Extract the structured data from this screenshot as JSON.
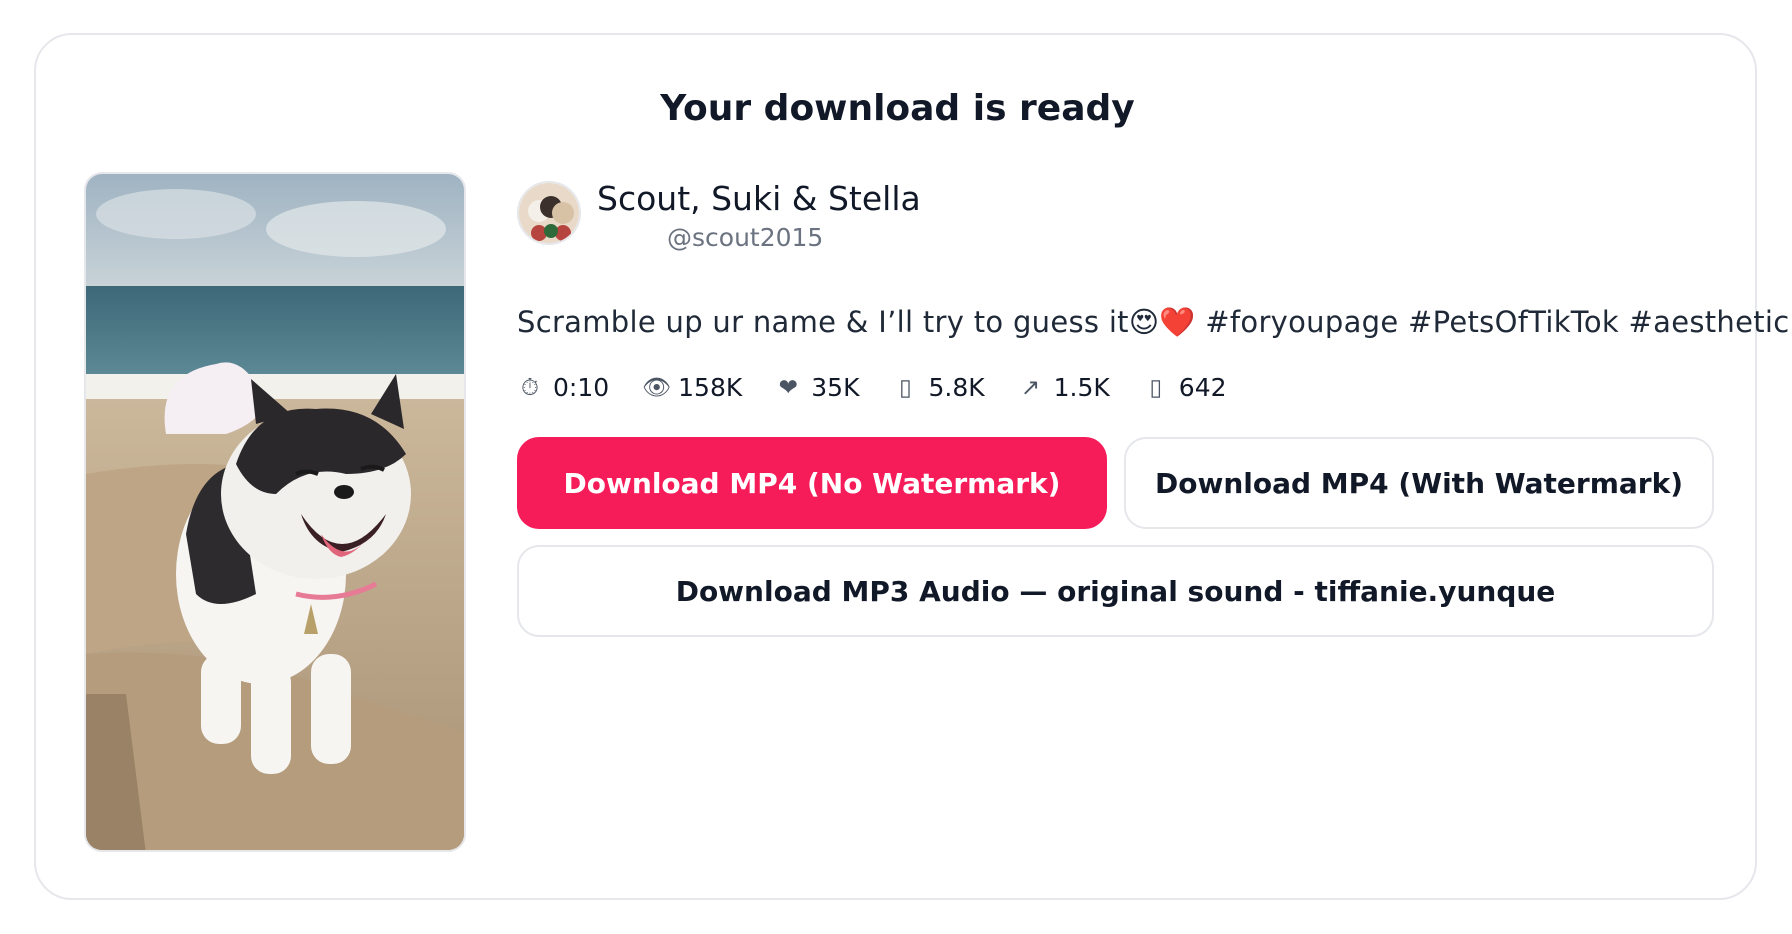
{
  "header": {
    "title": "Your download is ready"
  },
  "video": {
    "thumbnail_icon": "dog-on-boat-thumbnail",
    "author": {
      "avatar_icon": "avatar-image",
      "name": "Scout, Suki & Stella",
      "handle": "@scout2015"
    },
    "caption": "Scramble up ur name & I’ll try to guess it😍❤️ #foryoupage #PetsOfTikTok #aesthetic",
    "stats": [
      {
        "icon": "timer-icon",
        "glyph": "⏱",
        "value": "0:10"
      },
      {
        "icon": "eye-icon",
        "glyph": "👁",
        "value": "158K"
      },
      {
        "icon": "heart-icon",
        "glyph": "❤",
        "value": "35K"
      },
      {
        "icon": "comment-icon",
        "glyph": "▯",
        "value": "5.8K"
      },
      {
        "icon": "share-icon",
        "glyph": "↗",
        "value": "1.5K"
      },
      {
        "icon": "bookmark-icon",
        "glyph": "▯",
        "value": "642"
      }
    ]
  },
  "actions": {
    "mp4_no_watermark": "Download MP4 (No Watermark)",
    "mp4_with_watermark": "Download MP4 (With Watermark)",
    "mp3_audio": "Download MP3 Audio — original sound - tiffanie.yunque"
  },
  "colors": {
    "accent": "#f61c5a",
    "border": "#e5e7eb",
    "muted_text": "#6b7280"
  }
}
